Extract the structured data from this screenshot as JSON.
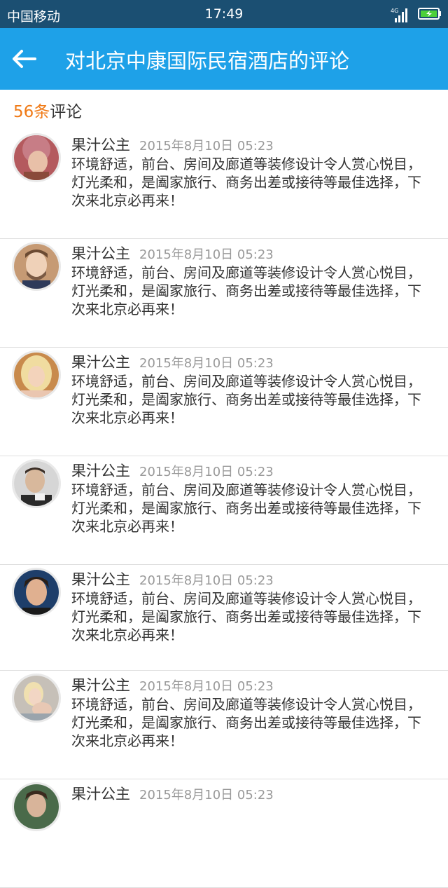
{
  "status_bar": {
    "carrier": "中国移动",
    "time": "17:49",
    "network": "4G"
  },
  "header": {
    "title": "对北京中康国际民宿酒店的评论",
    "back_icon": "back-arrow-icon"
  },
  "summary": {
    "count": "56条",
    "label": "评论"
  },
  "reviews": [
    {
      "author": "果汁公主",
      "date": "2015年8月10日  05:23",
      "text": "环境舒适，前台、房间及廊道等装修设计令人赏心悦目，灯光柔和，是阖家旅行、商务出差或接待等最佳选择，下次来北京必再来！"
    },
    {
      "author": "果汁公主",
      "date": "2015年8月10日  05:23",
      "text": "环境舒适，前台、房间及廊道等装修设计令人赏心悦目，灯光柔和，是阖家旅行、商务出差或接待等最佳选择，下次来北京必再来！"
    },
    {
      "author": "果汁公主",
      "date": "2015年8月10日  05:23",
      "text": "环境舒适，前台、房间及廊道等装修设计令人赏心悦目，灯光柔和，是阖家旅行、商务出差或接待等最佳选择，下次来北京必再来！"
    },
    {
      "author": "果汁公主",
      "date": "2015年8月10日  05:23",
      "text": "环境舒适，前台、房间及廊道等装修设计令人赏心悦目，灯光柔和，是阖家旅行、商务出差或接待等最佳选择，下次来北京必再来！"
    },
    {
      "author": "果汁公主",
      "date": "2015年8月10日  05:23",
      "text": "环境舒适，前台、房间及廊道等装修设计令人赏心悦目，灯光柔和，是阖家旅行、商务出差或接待等最佳选择，下次来北京必再来！"
    },
    {
      "author": "果汁公主",
      "date": "2015年8月10日  05:23",
      "text": "环境舒适，前台、房间及廊道等装修设计令人赏心悦目，灯光柔和，是阖家旅行、商务出差或接待等最佳选择，下次来北京必再来！"
    },
    {
      "author": "果汁公主",
      "date": "2015年8月10日  05:23",
      "text": ""
    }
  ],
  "colors": {
    "status_bar": "#1b4f72",
    "header": "#1ea1e8",
    "count_accent": "#f07a16"
  }
}
